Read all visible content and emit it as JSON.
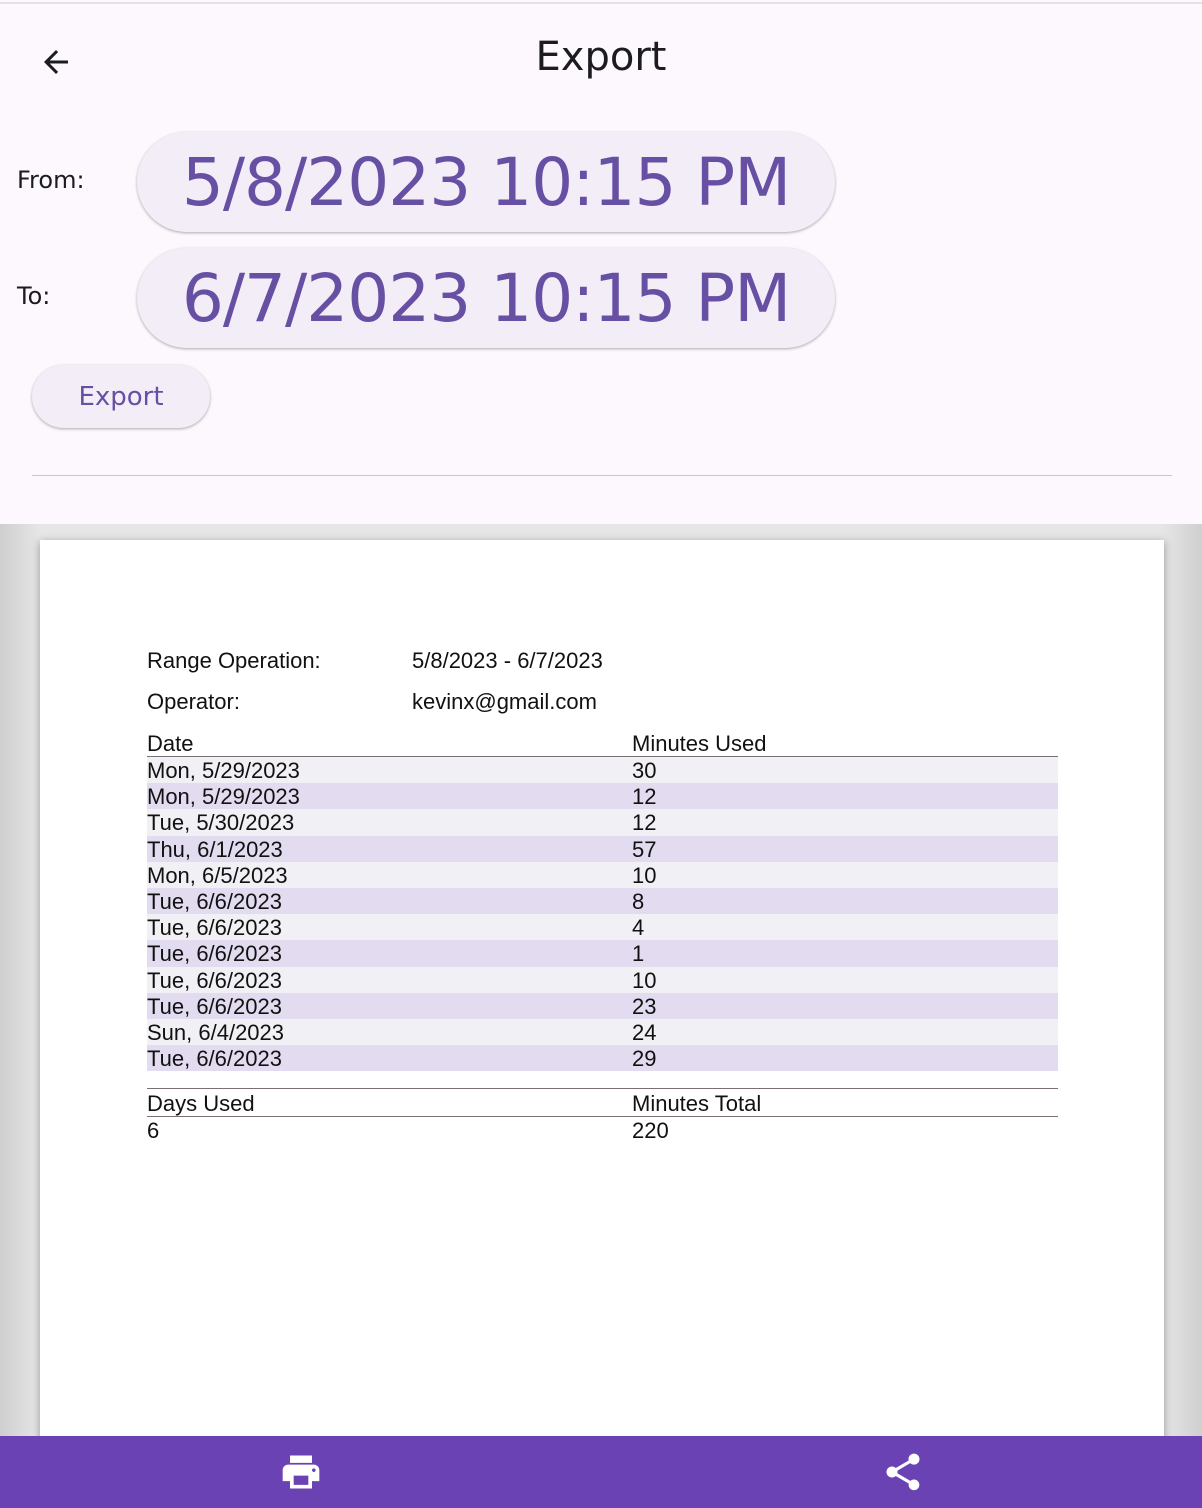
{
  "appbar": {
    "title": "Export",
    "back_icon": "arrow-back-icon"
  },
  "range": {
    "from_label": "From:",
    "from_value": "5/8/2023 10:15 PM",
    "to_label": "To:",
    "to_value": "6/7/2023 10:15 PM"
  },
  "actions": {
    "export_label": "Export"
  },
  "report": {
    "range_label": "Range Operation:",
    "range_value": "5/8/2023 - 6/7/2023",
    "operator_label": "Operator:",
    "operator_value": "kevinx@gmail.com",
    "headers": [
      "Date",
      "Minutes Used"
    ],
    "rows": [
      [
        "Mon, 5/29/2023",
        "30"
      ],
      [
        "Mon, 5/29/2023",
        "12"
      ],
      [
        "Tue, 5/30/2023",
        "12"
      ],
      [
        "Thu, 6/1/2023",
        "57"
      ],
      [
        "Mon, 6/5/2023",
        "10"
      ],
      [
        "Tue, 6/6/2023",
        "8"
      ],
      [
        "Tue, 6/6/2023",
        "4"
      ],
      [
        "Tue, 6/6/2023",
        "1"
      ],
      [
        "Tue, 6/6/2023",
        "10"
      ],
      [
        "Tue, 6/6/2023",
        "23"
      ],
      [
        "Sun, 6/4/2023",
        "24"
      ],
      [
        "Tue, 6/6/2023",
        "29"
      ]
    ],
    "summary_headers": [
      "Days Used",
      "Minutes Total"
    ],
    "summary_values": [
      "6",
      "220"
    ]
  },
  "bottom_bar": {
    "print_icon": "print-icon",
    "share_icon": "share-icon",
    "color": "#6b42b4"
  },
  "colors": {
    "accent": "#6750a4",
    "row_alt": "#e3dcf0",
    "row_base": "#f1f0f4"
  }
}
